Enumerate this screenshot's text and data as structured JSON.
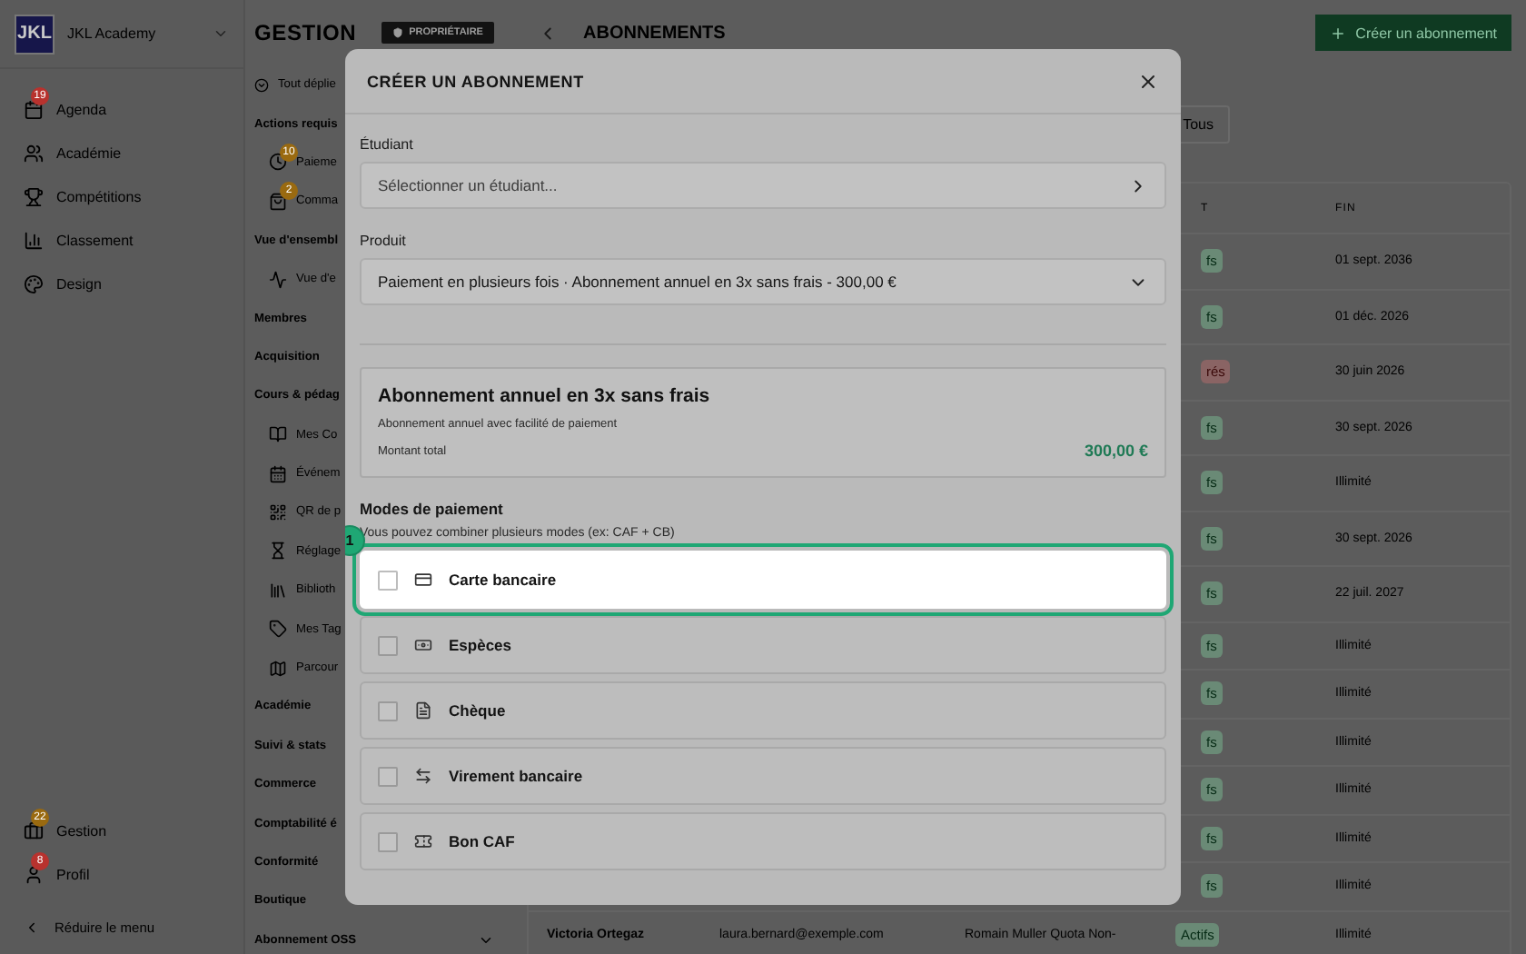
{
  "sidebar": {
    "logo": "JKL",
    "name": "JKL Academy",
    "items": [
      {
        "label": "Agenda",
        "badge": "19",
        "color": "#b8322e"
      },
      {
        "label": "Académie"
      },
      {
        "label": "Compétitions"
      },
      {
        "label": "Classement"
      },
      {
        "label": "Design"
      }
    ],
    "bottom_items": [
      {
        "label": "Gestion",
        "badge": "22",
        "color": "#9a6a10"
      },
      {
        "label": "Profil",
        "badge": "8",
        "color": "#b8322e"
      }
    ],
    "collapse": "Réduire le menu"
  },
  "section": {
    "title": "GESTION",
    "role_badge": "PROPRIÉTAIRE",
    "expand_all": "Tout déplie",
    "groups": [
      {
        "label": "Actions requis",
        "children": [
          {
            "label": "Paieme",
            "badge": "10"
          },
          {
            "label": "Comma",
            "badge": "2"
          }
        ]
      },
      {
        "label": "Vue d'ensembl",
        "children": [
          {
            "label": "Vue d'e"
          }
        ]
      },
      {
        "label": "Membres"
      },
      {
        "label": "Acquisition"
      },
      {
        "label": "Cours & pédag",
        "children": [
          {
            "label": "Mes Co"
          },
          {
            "label": "Événem"
          },
          {
            "label": "QR de p"
          },
          {
            "label": "Réglage"
          },
          {
            "label": "Biblioth"
          },
          {
            "label": "Mes Tag"
          },
          {
            "label": "Parcour"
          }
        ]
      },
      {
        "label": "Académie"
      },
      {
        "label": "Suivi & stats"
      },
      {
        "label": "Commerce"
      },
      {
        "label": "Comptabilité é"
      },
      {
        "label": "Conformité"
      },
      {
        "label": "Boutique"
      },
      {
        "label": "Abonnement OSS",
        "chevron": true
      }
    ]
  },
  "page": {
    "title": "ABONNEMENTS",
    "create_button": "Créer un abonnement",
    "filter": "Tous",
    "table": {
      "columns": [
        "T",
        "FIN"
      ],
      "rows": [
        {
          "status": "fs",
          "expired": false,
          "end": "01 sept. 2036"
        },
        {
          "status": "fs",
          "expired": false,
          "end": "01 déc. 2026"
        },
        {
          "status": "rés",
          "expired": true,
          "end": "30 juin 2026"
        },
        {
          "status": "fs",
          "expired": false,
          "end": "30 sept. 2026"
        },
        {
          "status": "fs",
          "expired": false,
          "end": "Illimité"
        },
        {
          "status": "fs",
          "expired": false,
          "end": "30 sept. 2026"
        },
        {
          "status": "fs",
          "expired": false,
          "end": "22 juil. 2027"
        },
        {
          "status": "fs",
          "expired": false,
          "end": "Illimité"
        },
        {
          "status": "fs",
          "expired": false,
          "end": "Illimité"
        },
        {
          "status": "fs",
          "expired": false,
          "end": "Illimité"
        },
        {
          "status": "fs",
          "expired": false,
          "end": "Illimité"
        },
        {
          "status": "fs",
          "expired": false,
          "end": "Illimité"
        },
        {
          "status": "fs",
          "expired": false,
          "end": "Illimité"
        },
        {
          "member": "Victoria Ortegaz",
          "email": "laura.bernard@exemple.com",
          "coach": "Romain Muller Quota Non-",
          "status": "Actifs",
          "expired": false,
          "end": "Illimité"
        }
      ]
    }
  },
  "modal": {
    "title": "CRÉER UN ABONNEMENT",
    "student": {
      "label": "Étudiant",
      "placeholder": "Sélectionner un étudiant..."
    },
    "product": {
      "label": "Produit",
      "value": "Paiement en plusieurs fois · Abonnement annuel en 3x sans frais - 300,00 €"
    },
    "summary": {
      "title": "Abonnement annuel en 3x sans frais",
      "description": "Abonnement annuel avec facilité de paiement",
      "total_label": "Montant total",
      "total": "300,00 €"
    },
    "payment": {
      "title": "Modes de paiement",
      "hint": "Vous pouvez combiner plusieurs modes (ex: CAF + CB)",
      "options": [
        {
          "label": "Carte bancaire",
          "checked": false,
          "highlighted": true,
          "step": "1"
        },
        {
          "label": "Espèces",
          "checked": false,
          "highlighted": false
        },
        {
          "label": "Chèque",
          "checked": false,
          "highlighted": false
        },
        {
          "label": "Virement bancaire",
          "checked": false,
          "highlighted": false
        },
        {
          "label": "Bon CAF",
          "checked": false,
          "highlighted": false
        }
      ]
    }
  }
}
